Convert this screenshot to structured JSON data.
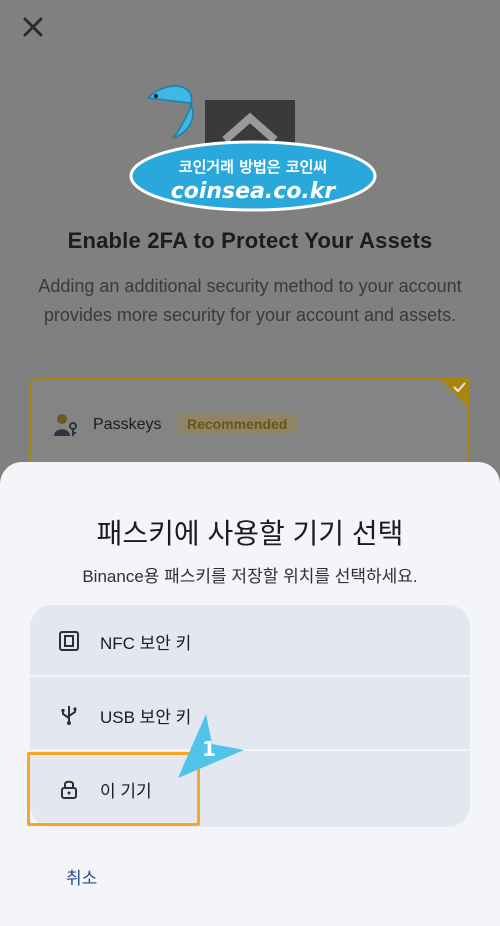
{
  "background": {
    "title": "Enable 2FA to Protect Your Assets",
    "description": "Adding an additional security method to your account provides more security for your account and assets.",
    "passkey_option": {
      "label": "Passkeys",
      "badge": "Recommended"
    }
  },
  "watermark": {
    "line1": "코인거래 방법은 코인씨",
    "line2": "coinsea.co.kr"
  },
  "sheet": {
    "title": "패스키에 사용할 기기 선택",
    "subtitle": "Binance용 패스키를 저장할 위치를 선택하세요.",
    "options": [
      {
        "label": "NFC 보안 키",
        "icon": "nfc-icon"
      },
      {
        "label": "USB 보안 키",
        "icon": "usb-icon"
      },
      {
        "label": "이 기기",
        "icon": "lock-icon"
      }
    ],
    "cancel_label": "취소"
  },
  "annotation": {
    "step_number": "1"
  },
  "colors": {
    "accent_orange": "#f5a623",
    "badge_gold": "#a8860d",
    "pointer_blue": "#4fc3e8"
  }
}
